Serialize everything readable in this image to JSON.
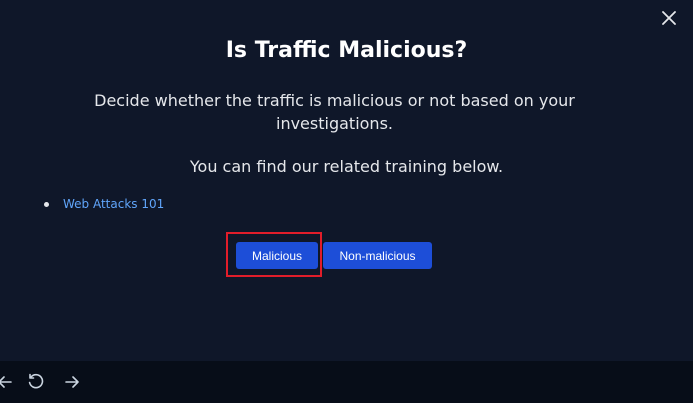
{
  "modal": {
    "title": "Is Traffic Malicious?",
    "description": "Decide whether the traffic is malicious or not based on your investigations.",
    "training_note": "You can find our related training below.",
    "training_links": [
      {
        "label": "Web Attacks 101"
      }
    ],
    "buttons": {
      "malicious": "Malicious",
      "non_malicious": "Non-malicious"
    },
    "close_icon": "close-icon"
  },
  "bottom_bar": {
    "icons": [
      "arrow-left-icon",
      "refresh-icon",
      "arrow-right-icon"
    ]
  },
  "colors": {
    "background": "#0f1729",
    "button": "#1d4ed8",
    "link": "#60a5fa",
    "highlight": "#e11d2a"
  }
}
